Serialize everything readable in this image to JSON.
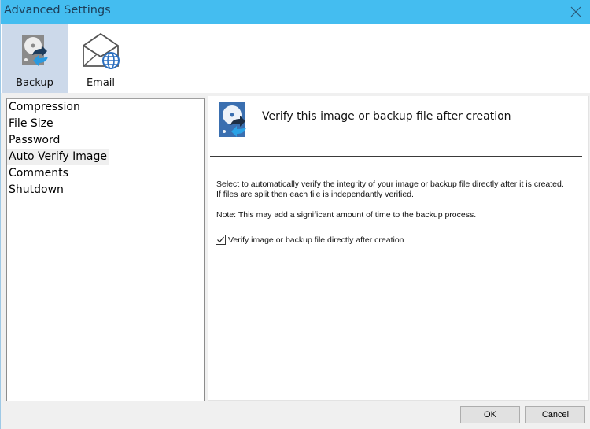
{
  "window": {
    "title": "Advanced Settings"
  },
  "toolbar": {
    "items": [
      {
        "label": "Backup",
        "icon": "backup-disk-icon",
        "active": true
      },
      {
        "label": "Email",
        "icon": "email-globe-icon",
        "active": false
      }
    ]
  },
  "sidebar": {
    "items": [
      {
        "label": "Compression"
      },
      {
        "label": "File Size"
      },
      {
        "label": "Password"
      },
      {
        "label": "Auto Verify Image",
        "selected": true
      },
      {
        "label": "Comments"
      },
      {
        "label": "Shutdown"
      }
    ]
  },
  "panel": {
    "heading": "Verify this image or backup file after creation",
    "description": "Select to automatically verify the integrity of your image or backup file directly after it is created. If files are split then each file is independantly verified.",
    "note": "Note: This may add a significant amount of time to the backup process.",
    "checkbox": {
      "label": "Verify image or backup file directly after creation",
      "checked": true
    }
  },
  "buttons": {
    "ok": "OK",
    "cancel": "Cancel"
  },
  "colors": {
    "titlebar": "#44bdf0",
    "active_tool": "#ccd9ea",
    "icon_blue": "#3a6fb0"
  }
}
